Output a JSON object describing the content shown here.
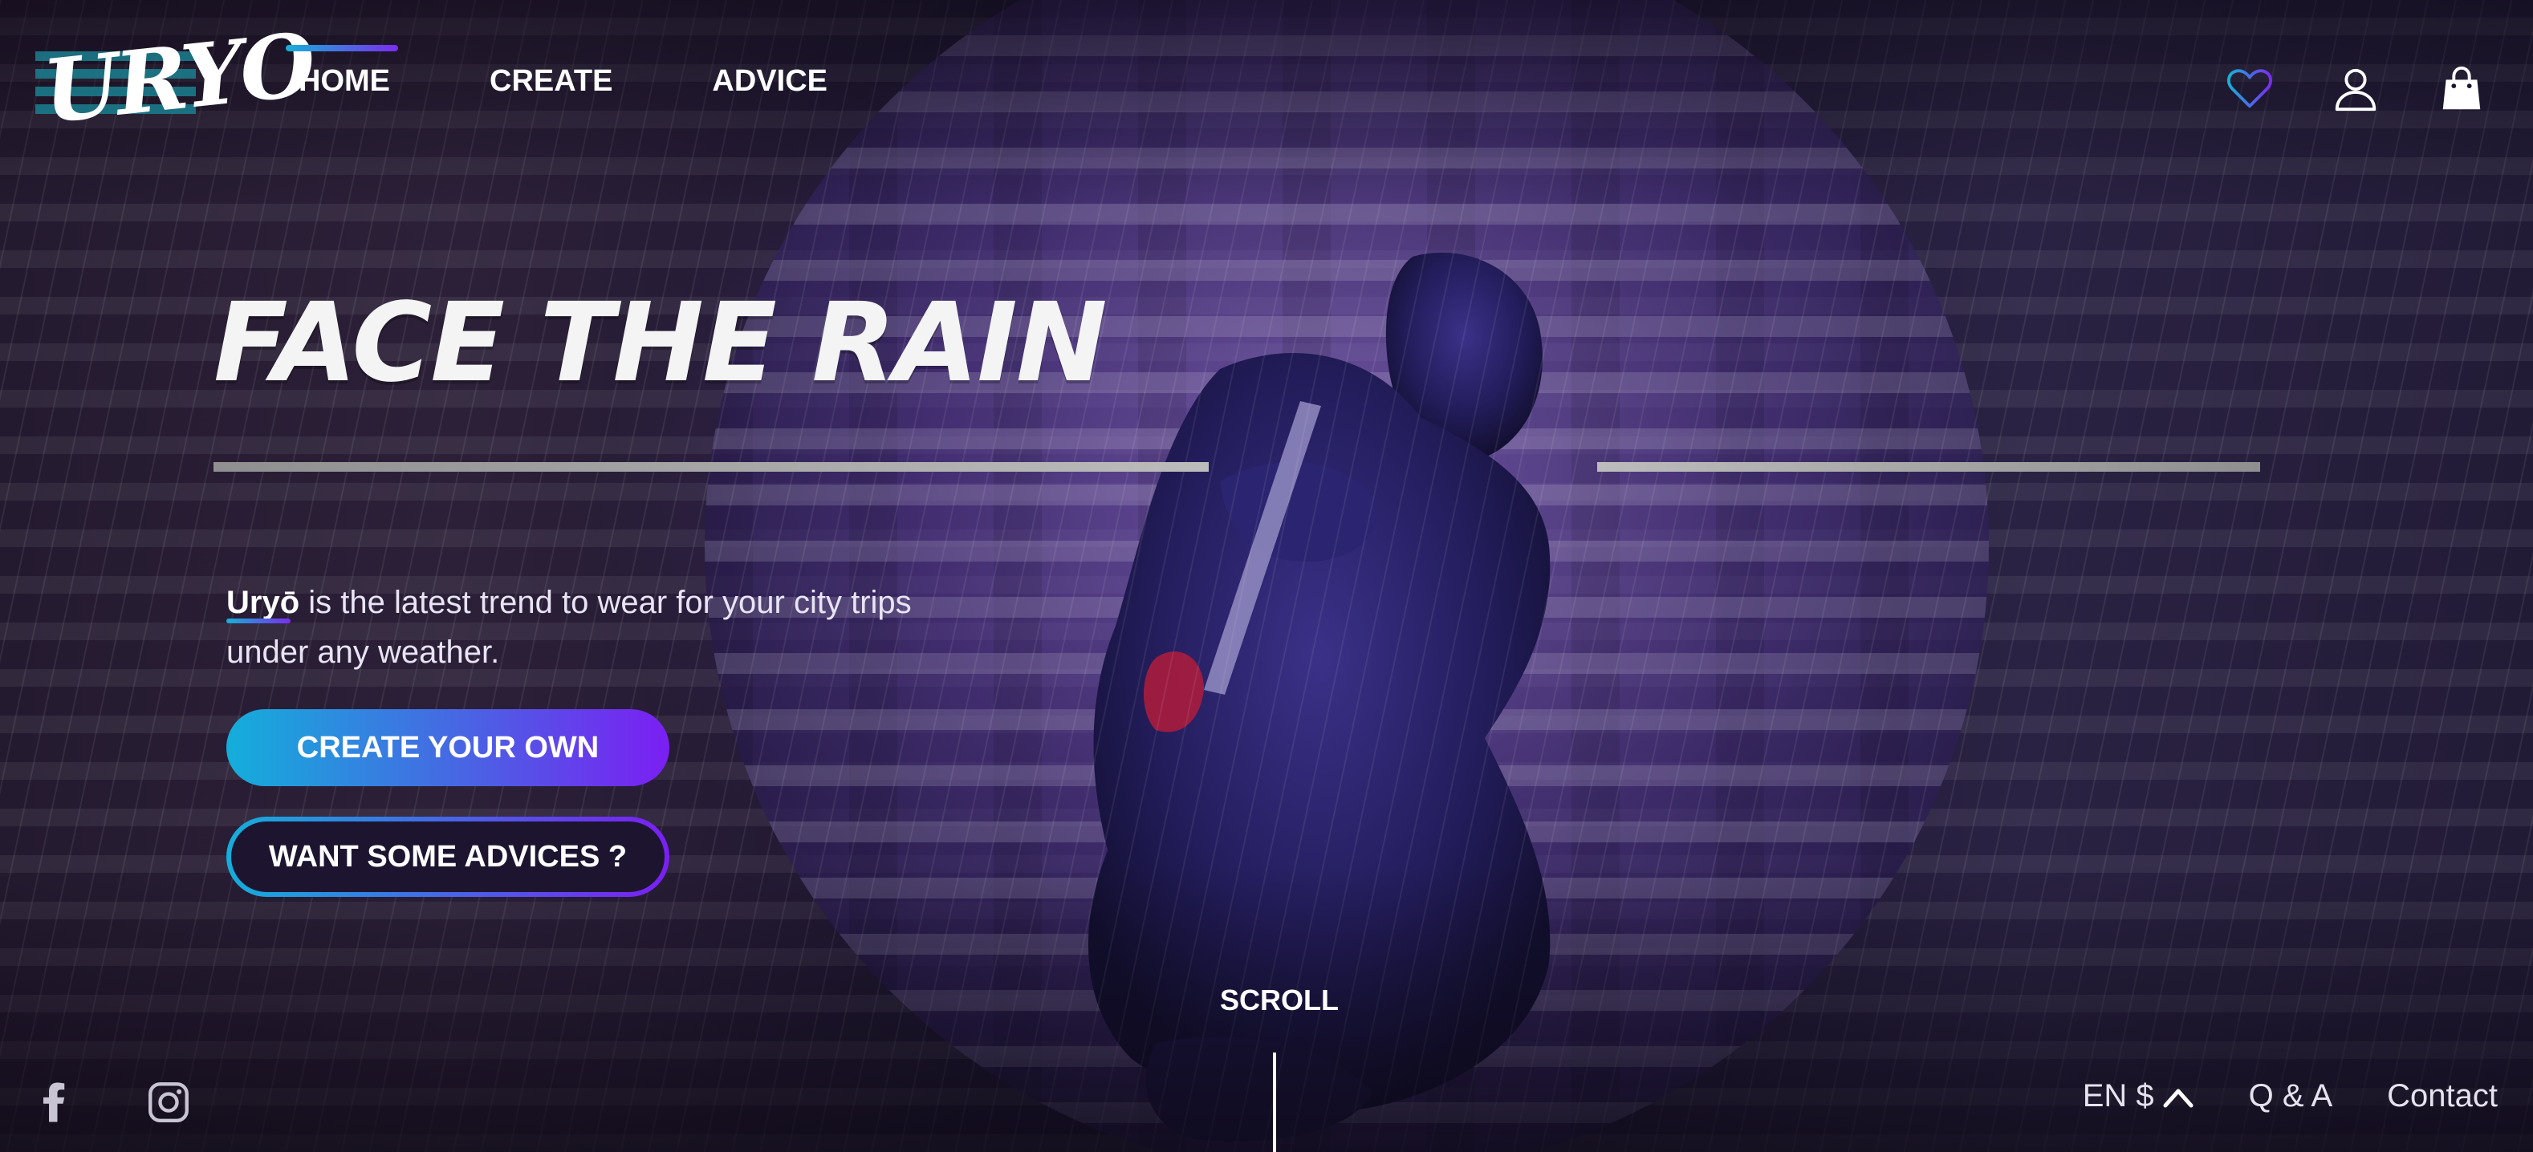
{
  "brand": {
    "logo_text": "URYO"
  },
  "nav": {
    "items": [
      {
        "label": "HOME",
        "active": true
      },
      {
        "label": "CREATE",
        "active": false
      },
      {
        "label": "ADVICE",
        "active": false
      }
    ]
  },
  "header_icons": [
    "heart-icon",
    "user-icon",
    "shopping-bag-icon"
  ],
  "hero": {
    "title": "FACE THE RAIN",
    "tagline_brand": "Uryō",
    "tagline_rest": " is the latest trend to wear for your city trips under any weather.",
    "primary_button": "CREATE YOUR OWN",
    "secondary_button": "WANT SOME ADVICES ?",
    "scroll_label": "SCROLL"
  },
  "footer": {
    "social": [
      "facebook-icon",
      "instagram-icon"
    ],
    "locale": "EN $",
    "qa_label": "Q & A",
    "contact_label": "Contact"
  },
  "colors": {
    "accent_start": "#16b0d8",
    "accent_end": "#7b2cf0",
    "background": "#1d1530"
  }
}
